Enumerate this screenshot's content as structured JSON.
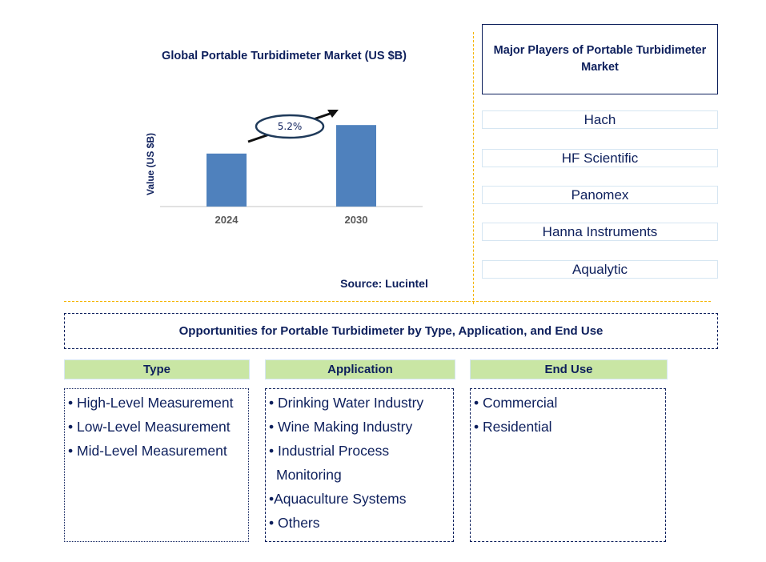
{
  "chart_data": {
    "type": "bar",
    "title": "Global Portable Turbidimeter Market (US $B)",
    "xlabel": "",
    "ylabel": "Value (US $B)",
    "categories": [
      "2024",
      "2030"
    ],
    "values": [
      0.65,
      1.0
    ],
    "value_note": "relative bar heights; no y-axis values shown",
    "ylim": [
      0,
      1.1
    ],
    "grid": false,
    "annotation": {
      "text": "5.2%",
      "meaning": "CAGR growth arrow from 2024 to 2030"
    },
    "bar_color": "#4f81bd",
    "source": "Source: Lucintel"
  },
  "players": {
    "title": "Major Players of Portable Turbidimeter Market",
    "items": [
      "Hach",
      "HF Scientific",
      "Panomex",
      "Hanna Instruments",
      "Aqualytic"
    ]
  },
  "opportunities": {
    "title": "Opportunities for Portable Turbidimeter by Type, Application, and End Use",
    "categories": [
      {
        "label": "Type",
        "items": [
          "• High-Level Measurement",
          "• Low-Level Measurement",
          "• Mid-Level Measurement"
        ]
      },
      {
        "label": "Application",
        "items": [
          "• Drinking Water Industry",
          "• Wine Making Industry",
          "• Industrial Process",
          "  Monitoring",
          "•Aquaculture Systems",
          "• Others"
        ]
      },
      {
        "label": "End Use",
        "items": [
          "• Commercial",
          "• Residential"
        ]
      }
    ]
  },
  "colors": {
    "text": "#0d1f5c",
    "bar": "#4f81bd",
    "header_fill": "#c9e6a4",
    "divider": "#f4b400"
  }
}
